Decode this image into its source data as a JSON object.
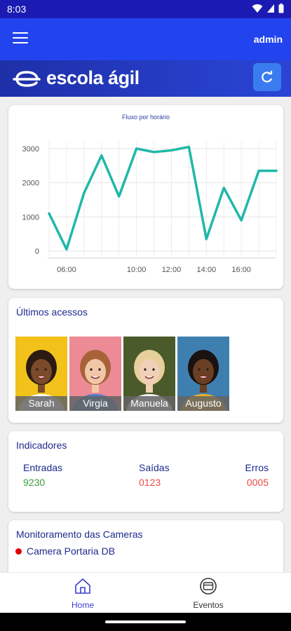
{
  "status_bar": {
    "time": "8:03"
  },
  "app_bar": {
    "user_label": "admin"
  },
  "brand": {
    "name": "escola ágil"
  },
  "chart_card": {
    "chart_data": {
      "type": "line",
      "title": "Fluxo por horário",
      "xlabel": "",
      "ylabel": "",
      "x": [
        "05:00",
        "06:00",
        "07:00",
        "08:00",
        "09:00",
        "10:00",
        "11:00",
        "12:00",
        "13:00",
        "14:00",
        "15:00",
        "16:00",
        "17:00",
        "18:00"
      ],
      "values": [
        1100,
        50,
        1700,
        2800,
        1600,
        3000,
        2900,
        2950,
        3050,
        350,
        1850,
        900,
        2350,
        2350
      ],
      "x_ticks": [
        "06:00",
        "10:00",
        "12:00",
        "14:00",
        "16:00"
      ],
      "y_ticks": [
        0,
        1000,
        2000,
        3000
      ],
      "ylim": [
        0,
        3000
      ],
      "grid": true,
      "line_color": "#1fb8a8"
    }
  },
  "last_access": {
    "title": "Últimos acessos",
    "people": [
      {
        "name": "Sarah",
        "bg": "#f2c21a",
        "skin": "#7a4a2a",
        "hair": "#2a1a12",
        "shirt": "#ffffff"
      },
      {
        "name": "Virgia",
        "bg": "#ec8a96",
        "skin": "#f1c7a8",
        "hair": "#a8623a",
        "shirt": "#4b7fc4"
      },
      {
        "name": "Manuela",
        "bg": "#4a5a2a",
        "skin": "#f0d0b6",
        "hair": "#e6cf9a",
        "shirt": "#f2f2f2"
      },
      {
        "name": "Augusto",
        "bg": "#3f7fb0",
        "skin": "#6b3f24",
        "hair": "#1a1210",
        "shirt": "#f0b020"
      }
    ]
  },
  "indicators": {
    "title": "Indicadores",
    "entries_label": "Entradas",
    "entries_value": "9230",
    "exits_label": "Saídas",
    "exits_value": "0123",
    "errors_label": "Erros",
    "errors_value": "0005",
    "colors": {
      "entries": "#3a9a3a",
      "exits": "#f04a4a",
      "errors": "#f04a4a"
    }
  },
  "cameras": {
    "title": "Monitoramento das Cameras",
    "items": [
      {
        "label": "Camera Portaria DB",
        "status_color": "#e00000"
      }
    ]
  },
  "bottom_nav": {
    "home_label": "Home",
    "events_label": "Eventos",
    "active_color": "#3b3fcf"
  },
  "colors": {
    "status_bar": "#1b1bb3",
    "app_bar": "#2244ee",
    "accent": "#3a7cf0",
    "heading": "#1d2a8c"
  }
}
